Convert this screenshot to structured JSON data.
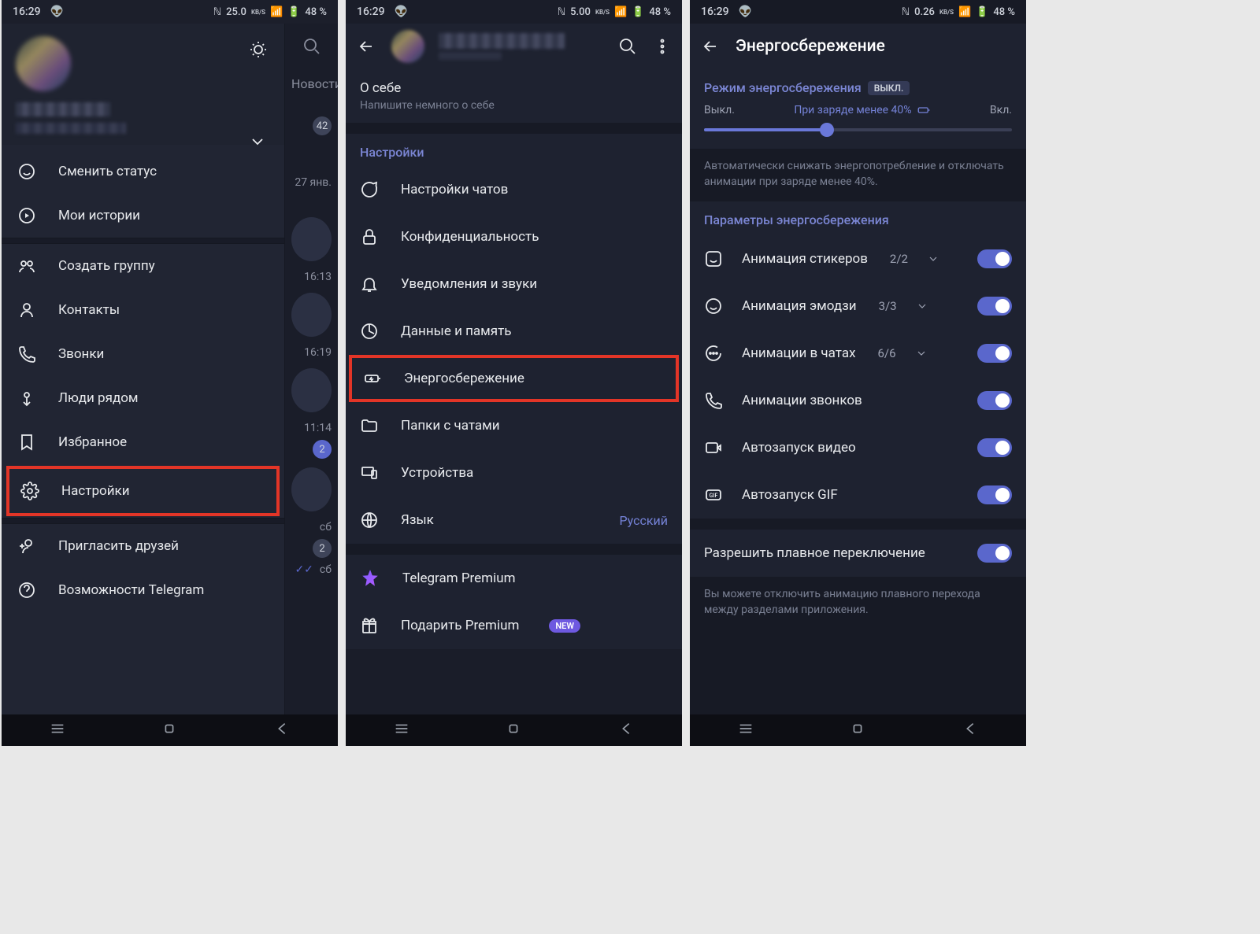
{
  "status": {
    "time": "16:29",
    "speed1": "25.0",
    "speed2": "5.00",
    "speed3": "0.26",
    "kbs": "KB/S",
    "battery": "48 %"
  },
  "behind": {
    "news_tab": "Новости",
    "badge1": "42",
    "date1": "27 янв.",
    "time1": "16:13",
    "time2": "16:19",
    "time3": "11:14",
    "dow1": "сб",
    "dow2": "сб",
    "unread1": "2",
    "unread2": "2"
  },
  "drawer": {
    "items": [
      {
        "label": "Сменить статус"
      },
      {
        "label": "Мои истории"
      },
      {
        "label": "Создать группу"
      },
      {
        "label": "Контакты"
      },
      {
        "label": "Звонки"
      },
      {
        "label": "Люди рядом"
      },
      {
        "label": "Избранное"
      },
      {
        "label": "Настройки"
      },
      {
        "label": "Пригласить друзей"
      },
      {
        "label": "Возможности Telegram"
      }
    ]
  },
  "settings": {
    "bio_title": "О себе",
    "bio_hint": "Напишите немного о себе",
    "section_hdr": "Настройки",
    "items": {
      "chats": "Настройки чатов",
      "privacy": "Конфиденциальность",
      "notif": "Уведомления и звуки",
      "data": "Данные и память",
      "power": "Энергосбережение",
      "folders": "Папки с чатами",
      "devices": "Устройства",
      "lang": "Язык",
      "lang_val": "Русский",
      "premium": "Telegram Premium",
      "gift": "Подарить Premium",
      "new_badge": "NEW"
    }
  },
  "power": {
    "title": "Энергосбережение",
    "mode_hdr": "Режим энергосбережения",
    "mode_state": "ВЫКЛ.",
    "slider_off": "Выкл.",
    "slider_mid": "При заряде менее 40%",
    "slider_on": "Вкл.",
    "hint1": "Автоматически снижать энергопотребление и отключать анимации при заряде менее 40%.",
    "params_hdr": "Параметры энергосбережения",
    "rows": {
      "stickers": "Анимация стикеров",
      "stickers_c": "2/2",
      "emoji": "Анимация эмодзи",
      "emoji_c": "3/3",
      "chats": "Анимации в чатах",
      "chats_c": "6/6",
      "calls": "Анимации звонков",
      "autovideo": "Автозапуск видео",
      "autogif": "Автозапуск GIF"
    },
    "smooth_label": "Разрешить плавное переключение",
    "hint2": "Вы можете отключить анимацию плавного перехода между разделами приложения."
  }
}
